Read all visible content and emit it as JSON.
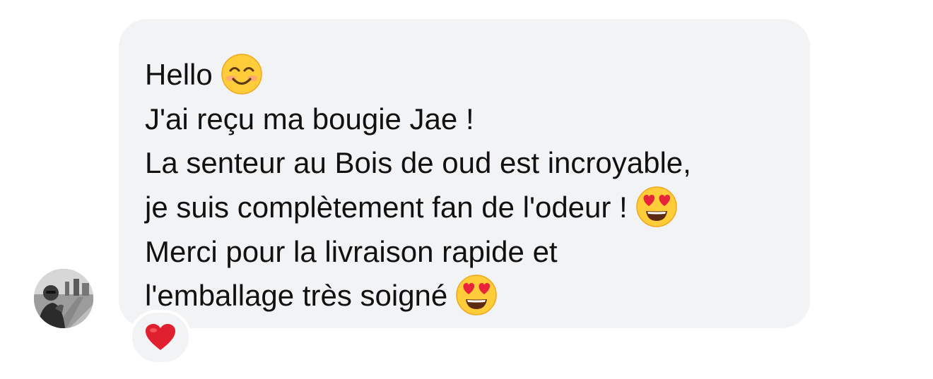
{
  "message": {
    "lines": [
      {
        "text": "Hello",
        "emoji": "smiling-face-with-smiling-eyes-icon"
      },
      {
        "text": "J'ai reçu ma bougie Jae !"
      },
      {
        "text": "La senteur au Bois de oud est incroyable,"
      },
      {
        "text": "je suis complètement fan de l'odeur !",
        "emoji": "smiling-face-with-heart-eyes-icon"
      },
      {
        "text": "Merci pour la livraison rapide et"
      },
      {
        "text": "l'emballage très soigné",
        "emoji": "smiling-face-with-heart-eyes-icon"
      }
    ],
    "reaction": "red-heart-icon"
  },
  "colors": {
    "bubble": "#f2f3f5",
    "text": "#111111",
    "emoji_face": "#ffcc3a",
    "heart": "#e0202e"
  }
}
